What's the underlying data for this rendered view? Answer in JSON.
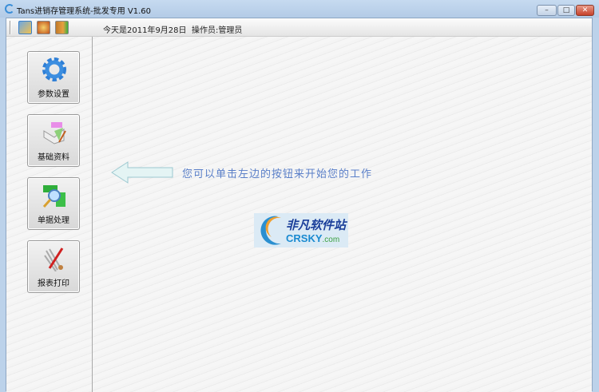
{
  "window": {
    "title": "Tans进销存管理系统-批发专用 V1.60",
    "minimize": "–",
    "maximize": "□",
    "close": "✕"
  },
  "toolbar": {
    "icons": [
      "settings-icon",
      "help-icon",
      "exit-icon"
    ],
    "date_text": "今天是2011年9月28日",
    "operator_text": "操作员:管理员"
  },
  "sidebar": {
    "items": [
      {
        "label": "参数设置",
        "icon": "gear-icon"
      },
      {
        "label": "基础资料",
        "icon": "book-icon"
      },
      {
        "label": "单据处理",
        "icon": "document-search-icon"
      },
      {
        "label": "报表打印",
        "icon": "report-print-icon"
      }
    ]
  },
  "main": {
    "hint": "您可以单击左边的按钮来开始您的工作",
    "logo_cn": "非凡软件站",
    "logo_en": "CRSKY",
    "logo_suffix": ".com"
  },
  "colors": {
    "hint": "#5a7fc8",
    "titlebar": "#c6daf0"
  }
}
